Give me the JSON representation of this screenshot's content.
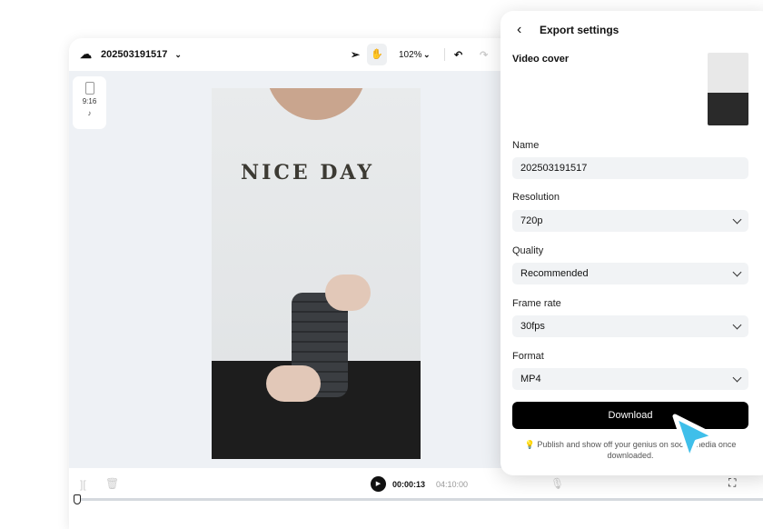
{
  "editor": {
    "project_name": "202503191517",
    "zoom": "102%",
    "aspect_ratio": "9:16",
    "current_time": "00:00:13",
    "total_time": "04:10:00",
    "cover_text": "NICE DAY"
  },
  "export": {
    "title": "Export settings",
    "video_cover_label": "Video cover",
    "name_label": "Name",
    "name_value": "202503191517",
    "resolution_label": "Resolution",
    "resolution_value": "720p",
    "quality_label": "Quality",
    "quality_value": "Recommended",
    "frame_rate_label": "Frame rate",
    "frame_rate_value": "30fps",
    "format_label": "Format",
    "format_value": "MP4",
    "download_label": "Download",
    "tip": "Publish and show off your genius on social media once downloaded."
  },
  "colors": {
    "cursor": "#3fbfea",
    "button": "#000000"
  }
}
